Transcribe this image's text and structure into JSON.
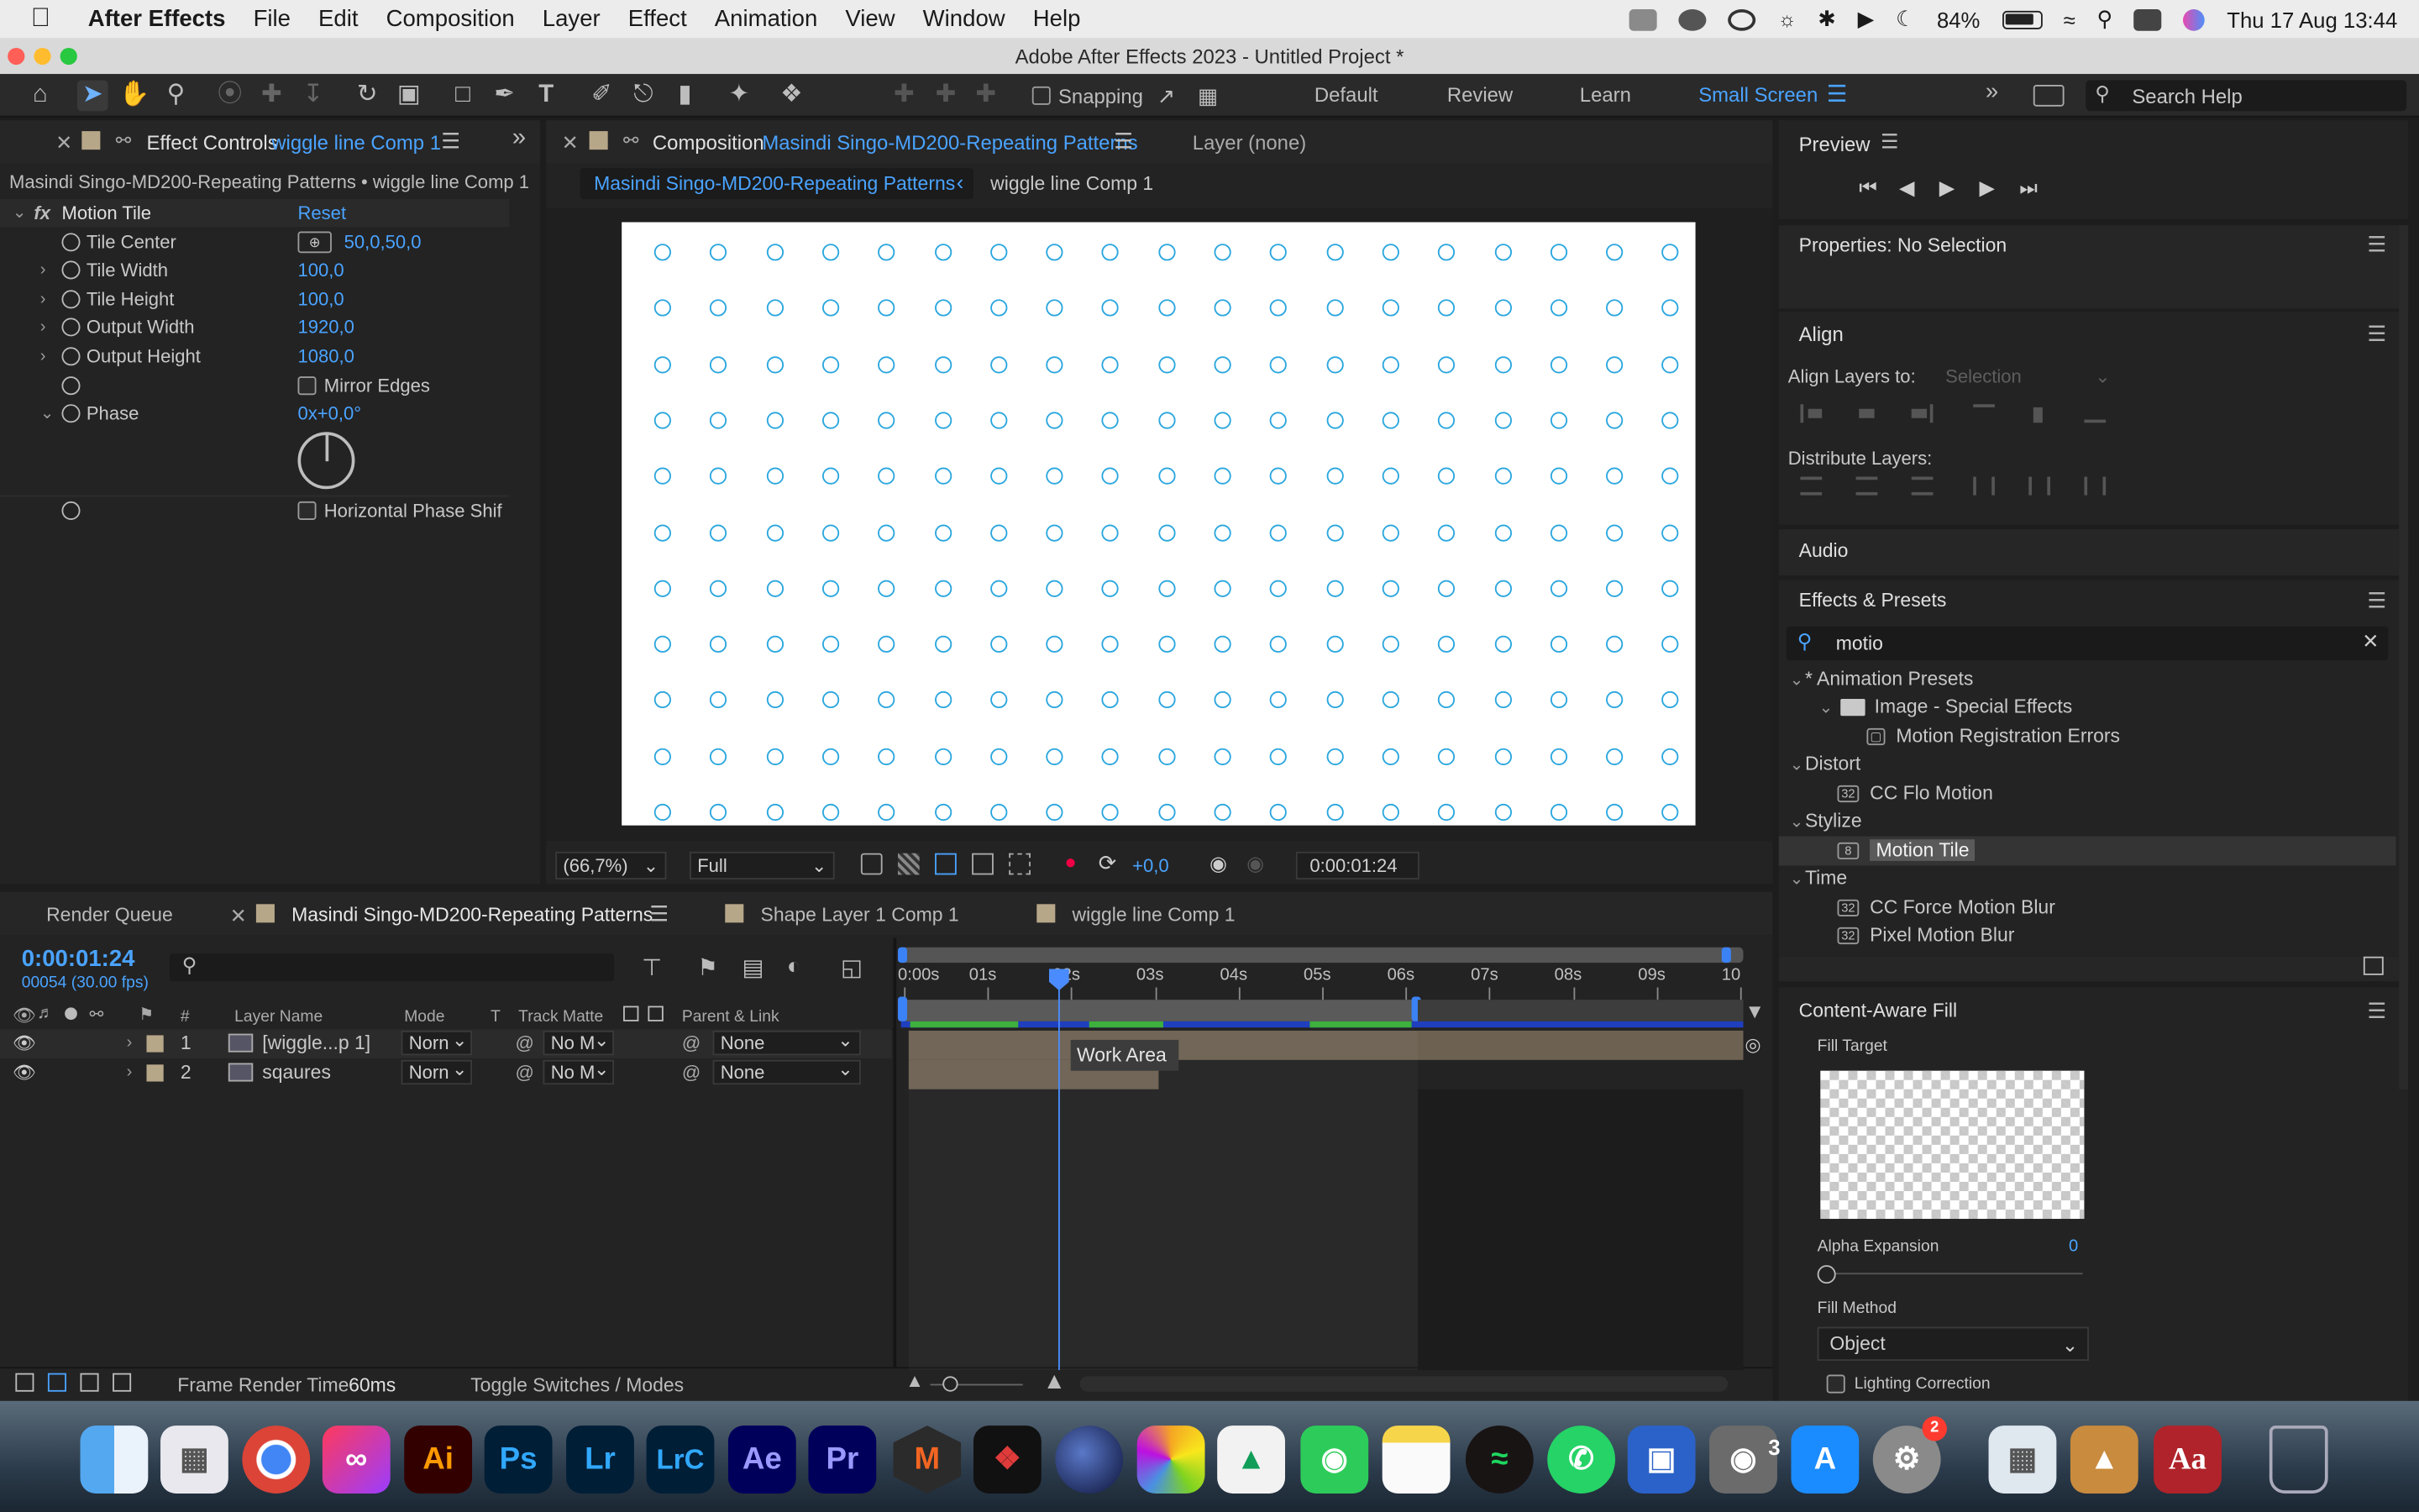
{
  "menubar": {
    "app": "After Effects",
    "items": [
      "File",
      "Edit",
      "Composition",
      "Layer",
      "Effect",
      "Animation",
      "View",
      "Window",
      "Help"
    ],
    "battery": "84%",
    "datetime": "Thu 17 Aug  13:44"
  },
  "window_title": "Adobe After Effects 2023 - Untitled Project *",
  "toolbar": {
    "snapping": "Snapping",
    "workspaces": [
      "Default",
      "Review",
      "Learn",
      "Small Screen"
    ],
    "active_workspace": "Small Screen",
    "search_help": "Search Help"
  },
  "effect_controls": {
    "tab_prefix": "Effect Controls",
    "tab_layer": "wiggle line Comp 1",
    "breadcrumb": "Masindi Singo-MD200-Repeating Patterns • wiggle line Comp 1",
    "effect_name": "Motion Tile",
    "reset": "Reset",
    "params": [
      {
        "label": "Tile Center",
        "value": "50,0,50,0"
      },
      {
        "label": "Tile Width",
        "value": "100,0"
      },
      {
        "label": "Tile Height",
        "value": "100,0"
      },
      {
        "label": "Output Width",
        "value": "1920,0"
      },
      {
        "label": "Output Height",
        "value": "1080,0"
      }
    ],
    "mirror_edges": "Mirror Edges",
    "phase_label": "Phase",
    "phase_value": "0x+0,0°",
    "horizontal_phase": "Horizontal Phase Shif"
  },
  "composition": {
    "tab_prefix": "Composition",
    "tab_name": "Masindi Singo-MD200-Repeating Patterns",
    "layer_tab": "Layer (none)",
    "crumb_1": "Masindi Singo-MD200-Repeating Patterns",
    "crumb_2": "wiggle line Comp 1",
    "zoom": "(66,7%)",
    "resolution": "Full",
    "exposure": "+0,0",
    "timecode": "0:00:01:24",
    "dot_color": "#29a6de"
  },
  "preview": {
    "title": "Preview"
  },
  "properties": {
    "title": "Properties: No Selection"
  },
  "align": {
    "title": "Align",
    "align_to_label": "Align Layers to:",
    "align_to_value": "Selection",
    "distribute_label": "Distribute Layers:"
  },
  "audio": {
    "title": "Audio"
  },
  "effects_presets": {
    "title": "Effects & Presets",
    "search": "motio",
    "tree": [
      {
        "text": "* Animation Presets",
        "kind": "folder"
      },
      {
        "text": "Image - Special Effects",
        "kind": "subfolder"
      },
      {
        "text": "Motion Registration Errors",
        "kind": "preset"
      },
      {
        "text": "Distort",
        "kind": "folder"
      },
      {
        "text": "CC Flo Motion",
        "kind": "effect"
      },
      {
        "text": "Stylize",
        "kind": "folder"
      },
      {
        "text": "Motion Tile",
        "kind": "effect-selected"
      },
      {
        "text": "Time",
        "kind": "folder"
      },
      {
        "text": "CC Force Motion Blur",
        "kind": "effect"
      },
      {
        "text": "Pixel Motion Blur",
        "kind": "effect"
      }
    ]
  },
  "content_aware": {
    "title": "Content-Aware Fill",
    "fill_target": "Fill Target",
    "alpha_expansion": "Alpha Expansion",
    "alpha_value": "0",
    "fill_method": "Fill Method",
    "fill_method_value": "Object",
    "lighting": "Lighting Correction"
  },
  "timeline": {
    "tabs": [
      "Render Queue",
      "Masindi Singo-MD200-Repeating Patterns",
      "Shape Layer 1 Comp 1",
      "wiggle line Comp 1"
    ],
    "timecode": "0:00:01:24",
    "frames": "00054 (30.00 fps)",
    "columns": {
      "hash": "#",
      "layer_name": "Layer Name",
      "mode": "Mode",
      "t": "T",
      "track_matte": "Track Matte",
      "parent": "Parent & Link"
    },
    "layers": [
      {
        "num": "1",
        "name": "[wiggle...p 1]",
        "mode": "Norn",
        "matte": "No M",
        "parent": "None"
      },
      {
        "num": "2",
        "name": "sqaures",
        "mode": "Norn",
        "matte": "No M",
        "parent": "None"
      }
    ],
    "ruler": [
      "0:00s",
      "01s",
      "02s",
      "03s",
      "04s",
      "05s",
      "06s",
      "07s",
      "08s",
      "09s",
      "10"
    ],
    "tooltip": "Work Area",
    "frame_render_label": "Frame Render Time",
    "frame_render_value": "60ms",
    "toggle": "Toggle Switches / Modes"
  },
  "dock": {
    "apps": [
      "Finder",
      "Launchpad",
      "Chrome",
      "Creative Cloud",
      "Ai",
      "Ps",
      "Lr",
      "LrC",
      "Ae",
      "Pr",
      "M",
      "Maxon",
      "Cinema 4D",
      "Photos",
      "Drive",
      "FaceTime",
      "Notes",
      "Spotify",
      "WhatsApp",
      "Screenpresso",
      "Image Capture",
      "App Store",
      "System Settings",
      "Preview",
      "Cat",
      "Dictionary",
      "Trash"
    ],
    "badge_settings": "2",
    "badge_capture": "3"
  }
}
